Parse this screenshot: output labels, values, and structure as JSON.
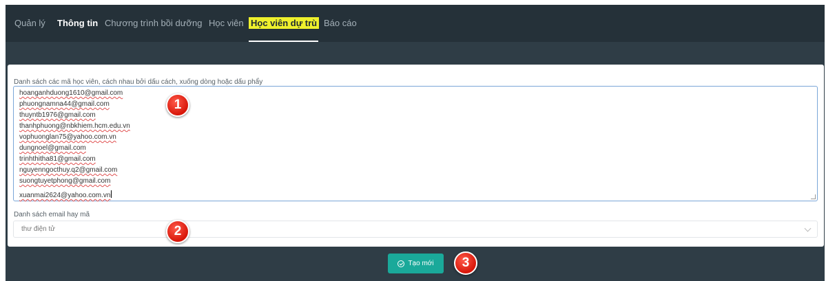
{
  "nav": {
    "tabs": [
      {
        "label": "Quản lý"
      },
      {
        "label": "Thông tin"
      },
      {
        "label": "Chương trình bồi dưỡng"
      },
      {
        "label": "Học viên"
      },
      {
        "label": "Học viên dự trù"
      },
      {
        "label": "Báo cáo"
      }
    ],
    "active_tab": "Học viên dự trù",
    "highlight_color": "#eef02c"
  },
  "form": {
    "codes_label": "Danh sách các mã học viên, cách nhau bởi dấu cách, xuống dòng hoặc dấu phẩy",
    "codes_value": [
      "hoanganhduong1610@gmail.com",
      "phuongnamna44@gmail.com",
      "thuyntb1976@gmail.com",
      "thanhphuong@nbkhiem.hcm.edu.vn",
      "vophuonglan75@yahoo.com.vn",
      "dungnoel@gmail.com",
      "trinhthitha81@gmail.com",
      "nguyenngocthuy.q2@gmail.com",
      "suongtuyetphong@gmail.com",
      "xuanmai2624@yahoo.com.vn"
    ],
    "type_label": "Danh sách email hay mã",
    "type_value": "thư điện tử"
  },
  "actions": {
    "create_label": "Tạo mới",
    "create_color": "#1aa99a"
  },
  "annotations": {
    "step1": "1",
    "step2": "2",
    "step3": "3"
  }
}
